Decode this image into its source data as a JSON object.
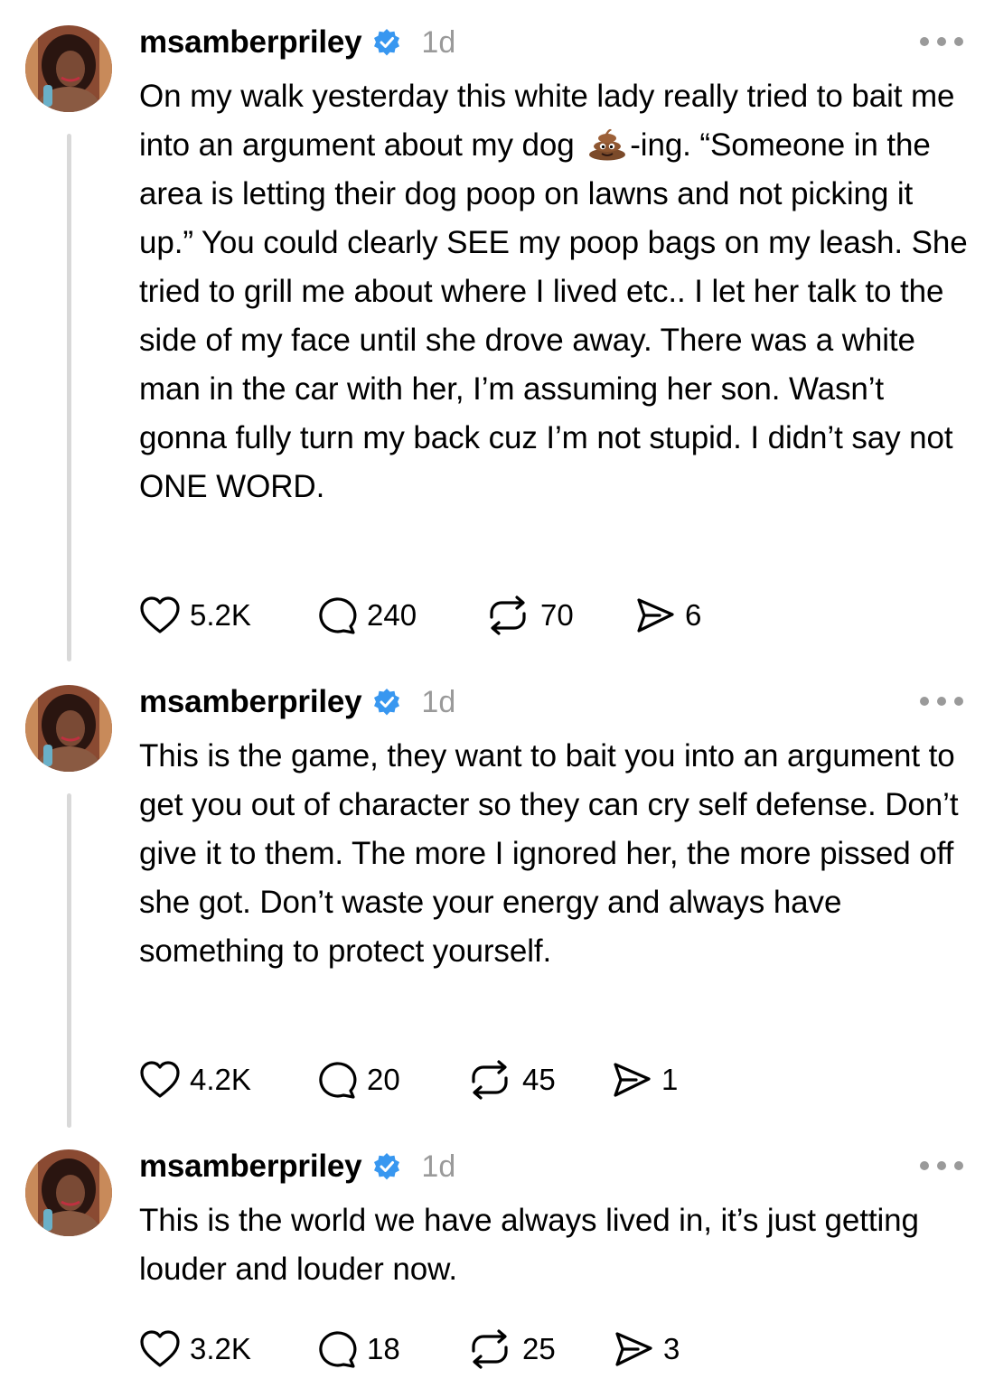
{
  "colors": {
    "verified": "#3897f0",
    "thread_line": "#d9d9d9",
    "muted": "#9a9a9a",
    "text": "#000000"
  },
  "posts": [
    {
      "username": "msamberpriley",
      "time": "1d",
      "text_before_emoji": "On my walk yesterday this white lady really tried to bait me into an argument about my dog",
      "emoji": "poop-emoji",
      "text_after_emoji": "-ing. “Someone in the area is letting their dog poop on lawns and not picking it up.” You could clearly SEE my poop bags on my leash. She tried to grill me about where I lived etc.. I let her talk to the side of my face until she drove away. There was a white man in the car with her, I’m assuming her son. Wasn’t gonna fully turn my back cuz I’m not stupid. I didn’t say not ONE WORD.",
      "likes": "5.2K",
      "replies": "240",
      "reposts": "70",
      "shares": "6"
    },
    {
      "username": "msamberpriley",
      "time": "1d",
      "text": "This is the game, they want to bait you into an argument to get you out of character so they can cry self defense. Don’t give it to them. The more I ignored her, the more pissed off she got. Don’t waste your energy and always have something to protect yourself.",
      "likes": "4.2K",
      "replies": "20",
      "reposts": "45",
      "shares": "1"
    },
    {
      "username": "msamberpriley",
      "time": "1d",
      "text": "This is the world we have always lived in, it’s just getting louder and louder now.",
      "likes": "3.2K",
      "replies": "18",
      "reposts": "25",
      "shares": "3"
    }
  ]
}
